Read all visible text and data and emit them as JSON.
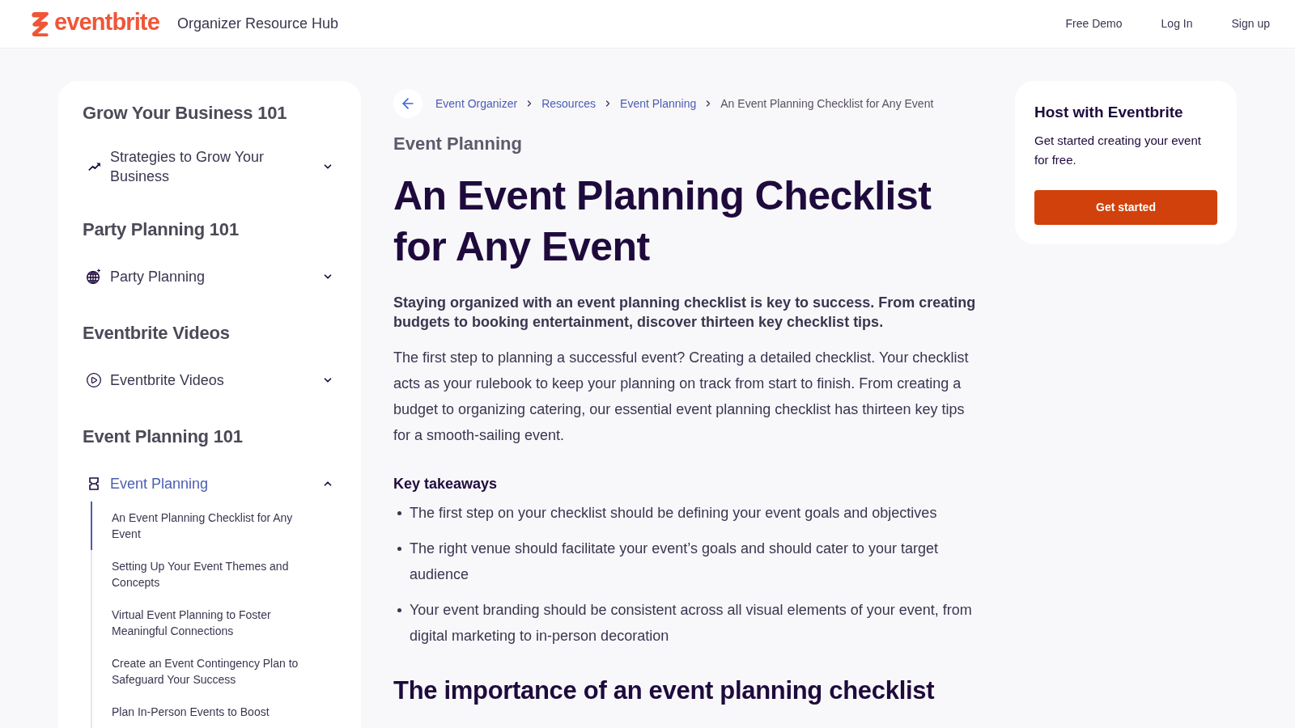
{
  "header": {
    "logo": {
      "wordmark": "eventbrite"
    },
    "title": "Organizer Resource Hub",
    "nav": [
      {
        "label": "Free Demo"
      },
      {
        "label": "Log In"
      },
      {
        "label": "Sign up"
      }
    ]
  },
  "sidebar": {
    "sections": [
      {
        "heading": "Grow Your Business 101",
        "items": [
          {
            "label": "Strategies to Grow Your Business",
            "expanded": false
          }
        ]
      },
      {
        "heading": "Party Planning 101",
        "items": [
          {
            "label": "Party Planning",
            "expanded": false
          }
        ]
      },
      {
        "heading": "Eventbrite Videos",
        "items": [
          {
            "label": "Eventbrite Videos",
            "expanded": false
          }
        ]
      },
      {
        "heading": "Event Planning 101",
        "items": [
          {
            "label": "Event Planning",
            "expanded": true,
            "children": [
              {
                "label": "An Event Planning Checklist for Any Event",
                "selected": true
              },
              {
                "label": "Setting Up Your Event Themes and Concepts",
                "selected": false
              },
              {
                "label": "Virtual Event Planning to Foster Meaningful Connections",
                "selected": false
              },
              {
                "label": "Create an Event Contingency Plan to Safeguard Your Success",
                "selected": false
              },
              {
                "label": "Plan In-Person Events to Boost",
                "selected": false
              }
            ]
          }
        ]
      }
    ]
  },
  "breadcrumb": [
    {
      "label": "Event Organizer",
      "current": false
    },
    {
      "label": "Resources",
      "current": false
    },
    {
      "label": "Event Planning",
      "current": false
    },
    {
      "label": "An Event Planning Checklist for Any Event",
      "current": true
    }
  ],
  "article": {
    "category": "Event Planning",
    "title": "An Event Planning Checklist for Any Event",
    "lead": "Staying organized with an event planning checklist is key to success. From creating budgets to booking entertainment, discover thirteen key checklist tips.",
    "body": "The first step to planning a successful event? Creating a detailed checklist. Your checklist acts as your rulebook to keep your planning on track from start to finish. From creating a budget to organizing catering, our essential event planning checklist has thirteen key tips for a smooth-sailing event.",
    "takeaways": {
      "heading": "Key takeaways",
      "items": [
        "The first step on your checklist should be defining your event goals and objectives",
        "The right venue should facilitate your event’s goals and should cater to your target audience",
        "Your event branding should be consistent across all visual elements of your event, from digital marketing to in-person decoration"
      ]
    },
    "section_heading": "The importance of an event planning checklist"
  },
  "promo": {
    "title": "Host with Eventbrite",
    "text": "Get started creating your event for free.",
    "button": "Get started"
  }
}
